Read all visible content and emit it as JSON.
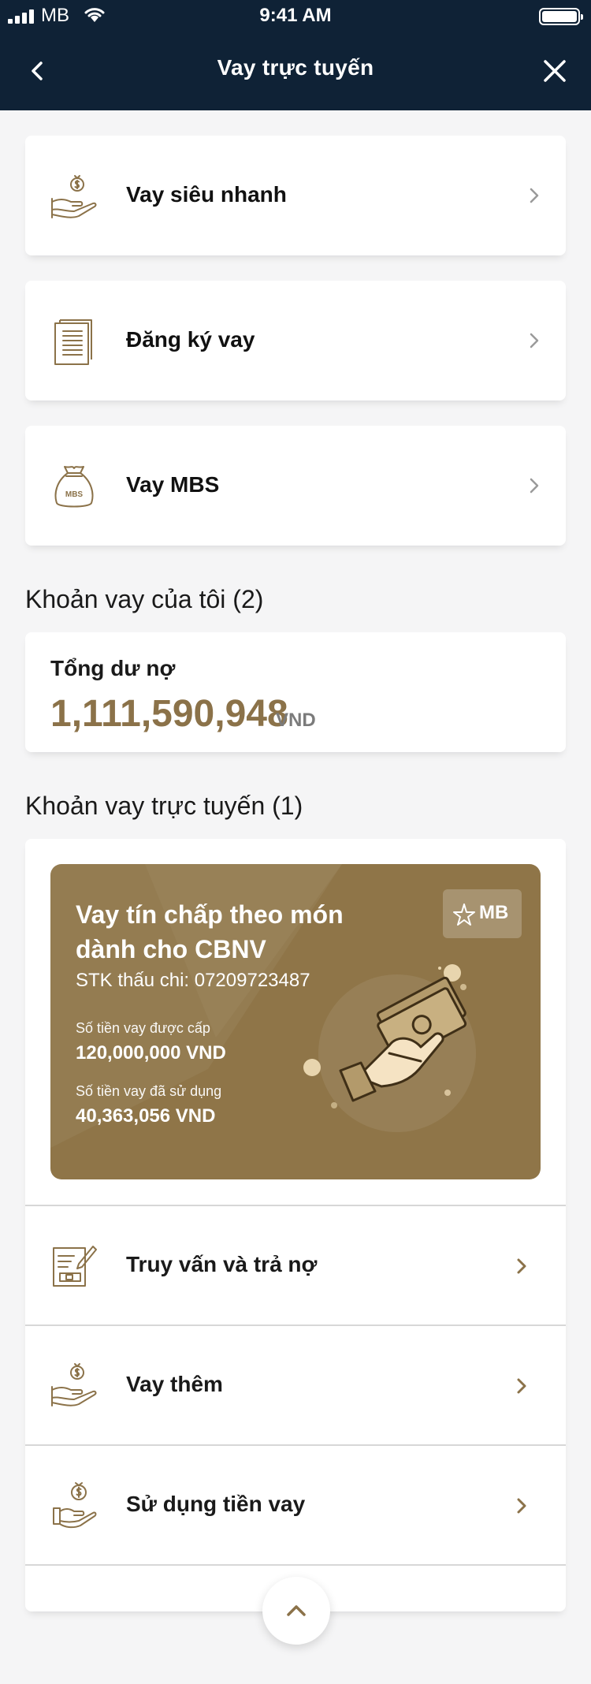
{
  "status_bar": {
    "carrier": "MB",
    "time": "9:41 AM"
  },
  "nav": {
    "title": "Vay trực tuyến"
  },
  "menu": [
    {
      "label": "Vay siêu nhanh",
      "icon": "hand-money-bag-icon"
    },
    {
      "label": "Đăng ký vay",
      "icon": "document-list-icon"
    },
    {
      "label": "Vay MBS",
      "icon": "mbs-bag-icon",
      "icon_text": "MBS"
    }
  ],
  "my_loans": {
    "title": "Khoản vay của tôi (2)",
    "debt_label": "Tổng dư nợ",
    "debt_amount": "1,111,590,948",
    "debt_currency": "VND"
  },
  "online_loans": {
    "title": "Khoản vay trực tuyến (1)",
    "banner": {
      "title": "Vay tín chấp theo món dành cho CBNV",
      "stk": "STK thấu chi: 07209723487",
      "badge": "MB",
      "granted_label": "Số tiền vay được cấp",
      "granted": "120,000,000 VND",
      "used_label": "Số tiền vay đã sử dụng",
      "used": "40,363,056 VND"
    },
    "actions": [
      {
        "label": "Truy vấn và trả nợ",
        "icon": "edit-document-icon"
      },
      {
        "label": "Vay thêm",
        "icon": "hand-money-bag-icon"
      },
      {
        "label": "Sử dụng tiền vay",
        "icon": "hand-coin-icon"
      }
    ]
  },
  "colors": {
    "header": "#0f2236",
    "accent": "#8b7249",
    "banner": "#8f7548",
    "background": "#f5f5f6"
  }
}
